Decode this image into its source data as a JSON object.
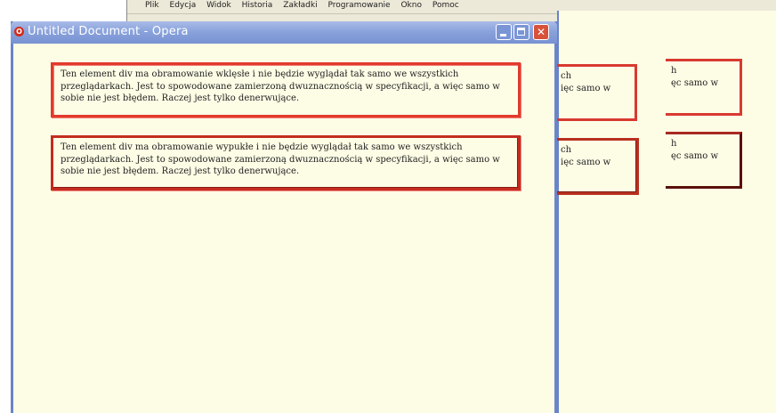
{
  "menu": {
    "items": [
      "Plik",
      "Edycja",
      "Widok",
      "Historia",
      "Zakładki",
      "Programowanie",
      "Okno",
      "Pomoc"
    ]
  },
  "front_window": {
    "title": "Untitled Document - Opera",
    "controls": {
      "minimize": "_",
      "maximize": "□",
      "close": "✕"
    }
  },
  "content": {
    "box1_text": "Ten element div ma obramowanie wklęsłe i nie będzie wyglądał tak samo we wszystkich przeglądarkach. Jest to spowodowane zamierzoną dwuznacznością w specyfikacji, a więc samo w sobie nie jest błędem. Raczej jest tylko denerwujące.",
    "box2_text": "Ten element div ma obramowanie wypukłe i nie będzie wyglądał tak samo we wszystkich przeglądarkach. Jest to spowodowane zamierzoną dwuznacznością w specyfikacji, a więc samo w sobie nie jest błędem. Raczej jest tylko denerwujące."
  },
  "background_windows": {
    "mid_box1_line1": "ch",
    "mid_box1_line2": "ięc samo w",
    "mid_box2_line1": "ch",
    "mid_box2_line2": "ięc samo w",
    "right_box1_line1": "h",
    "right_box1_line2": "ęc samo w",
    "right_box2_line1": "h",
    "right_box2_line2": "ęc samo w"
  },
  "toolbar": {
    "page_icon": "page-menu-icon",
    "gear_icon": "gear-icon"
  },
  "colors": {
    "title_bar": "#8aa3dc",
    "window_border": "#6b85c9",
    "close_button": "#d8513a",
    "content_bg": "#fdfde6",
    "border_red": "#e23a2d"
  }
}
